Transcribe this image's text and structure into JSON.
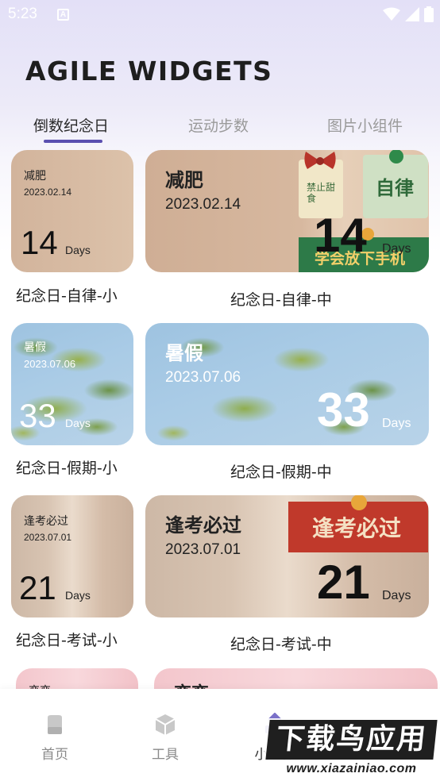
{
  "status": {
    "time": "5:23",
    "notification": "A"
  },
  "app": {
    "title": "AGILE WIDGETS"
  },
  "tabs": [
    {
      "label": "倒数纪念日",
      "active": true
    },
    {
      "label": "运动步数",
      "active": false
    },
    {
      "label": "图片小组件",
      "active": false
    }
  ],
  "widgets": [
    {
      "small": {
        "title": "减肥",
        "date": "2023.02.14",
        "days": "14",
        "unit": "Days",
        "caption": "纪念日-自律-小"
      },
      "medium": {
        "title": "减肥",
        "date": "2023.02.14",
        "days": "14",
        "unit": "Days",
        "caption": "纪念日-自律-中",
        "deco_texts": [
          "禁止甜食",
          "自律",
          "学会放下手机"
        ]
      }
    },
    {
      "small": {
        "title": "暑假",
        "date": "2023.07.06",
        "days": "33",
        "unit": "Days",
        "caption": "纪念日-假期-小"
      },
      "medium": {
        "title": "暑假",
        "date": "2023.07.06",
        "days": "33",
        "unit": "Days",
        "caption": "纪念日-假期-中"
      }
    },
    {
      "small": {
        "title": "逢考必过",
        "date": "2023.07.01",
        "days": "21",
        "unit": "Days",
        "caption": "纪念日-考试-小"
      },
      "medium": {
        "title": "逢考必过",
        "date": "2023.07.01",
        "days": "21",
        "unit": "Days",
        "caption": "纪念日-考试-中",
        "deco_text": "逢考必过"
      }
    },
    {
      "small": {
        "title": "恋恋"
      },
      "medium": {
        "title": "恋恋"
      }
    }
  ],
  "nav": [
    {
      "label": "首页",
      "icon": "home-icon"
    },
    {
      "label": "工具",
      "icon": "cube-icon"
    },
    {
      "label": "小组件",
      "icon": "widget-icon",
      "active": true
    }
  ],
  "watermark": {
    "main": "下载鸟应用",
    "sub": "www.xiazainiao.com"
  },
  "colors": {
    "accent": "#5a4fb0",
    "text_dark": "#1e1e1e",
    "tab_inactive": "#9a9a9a"
  }
}
